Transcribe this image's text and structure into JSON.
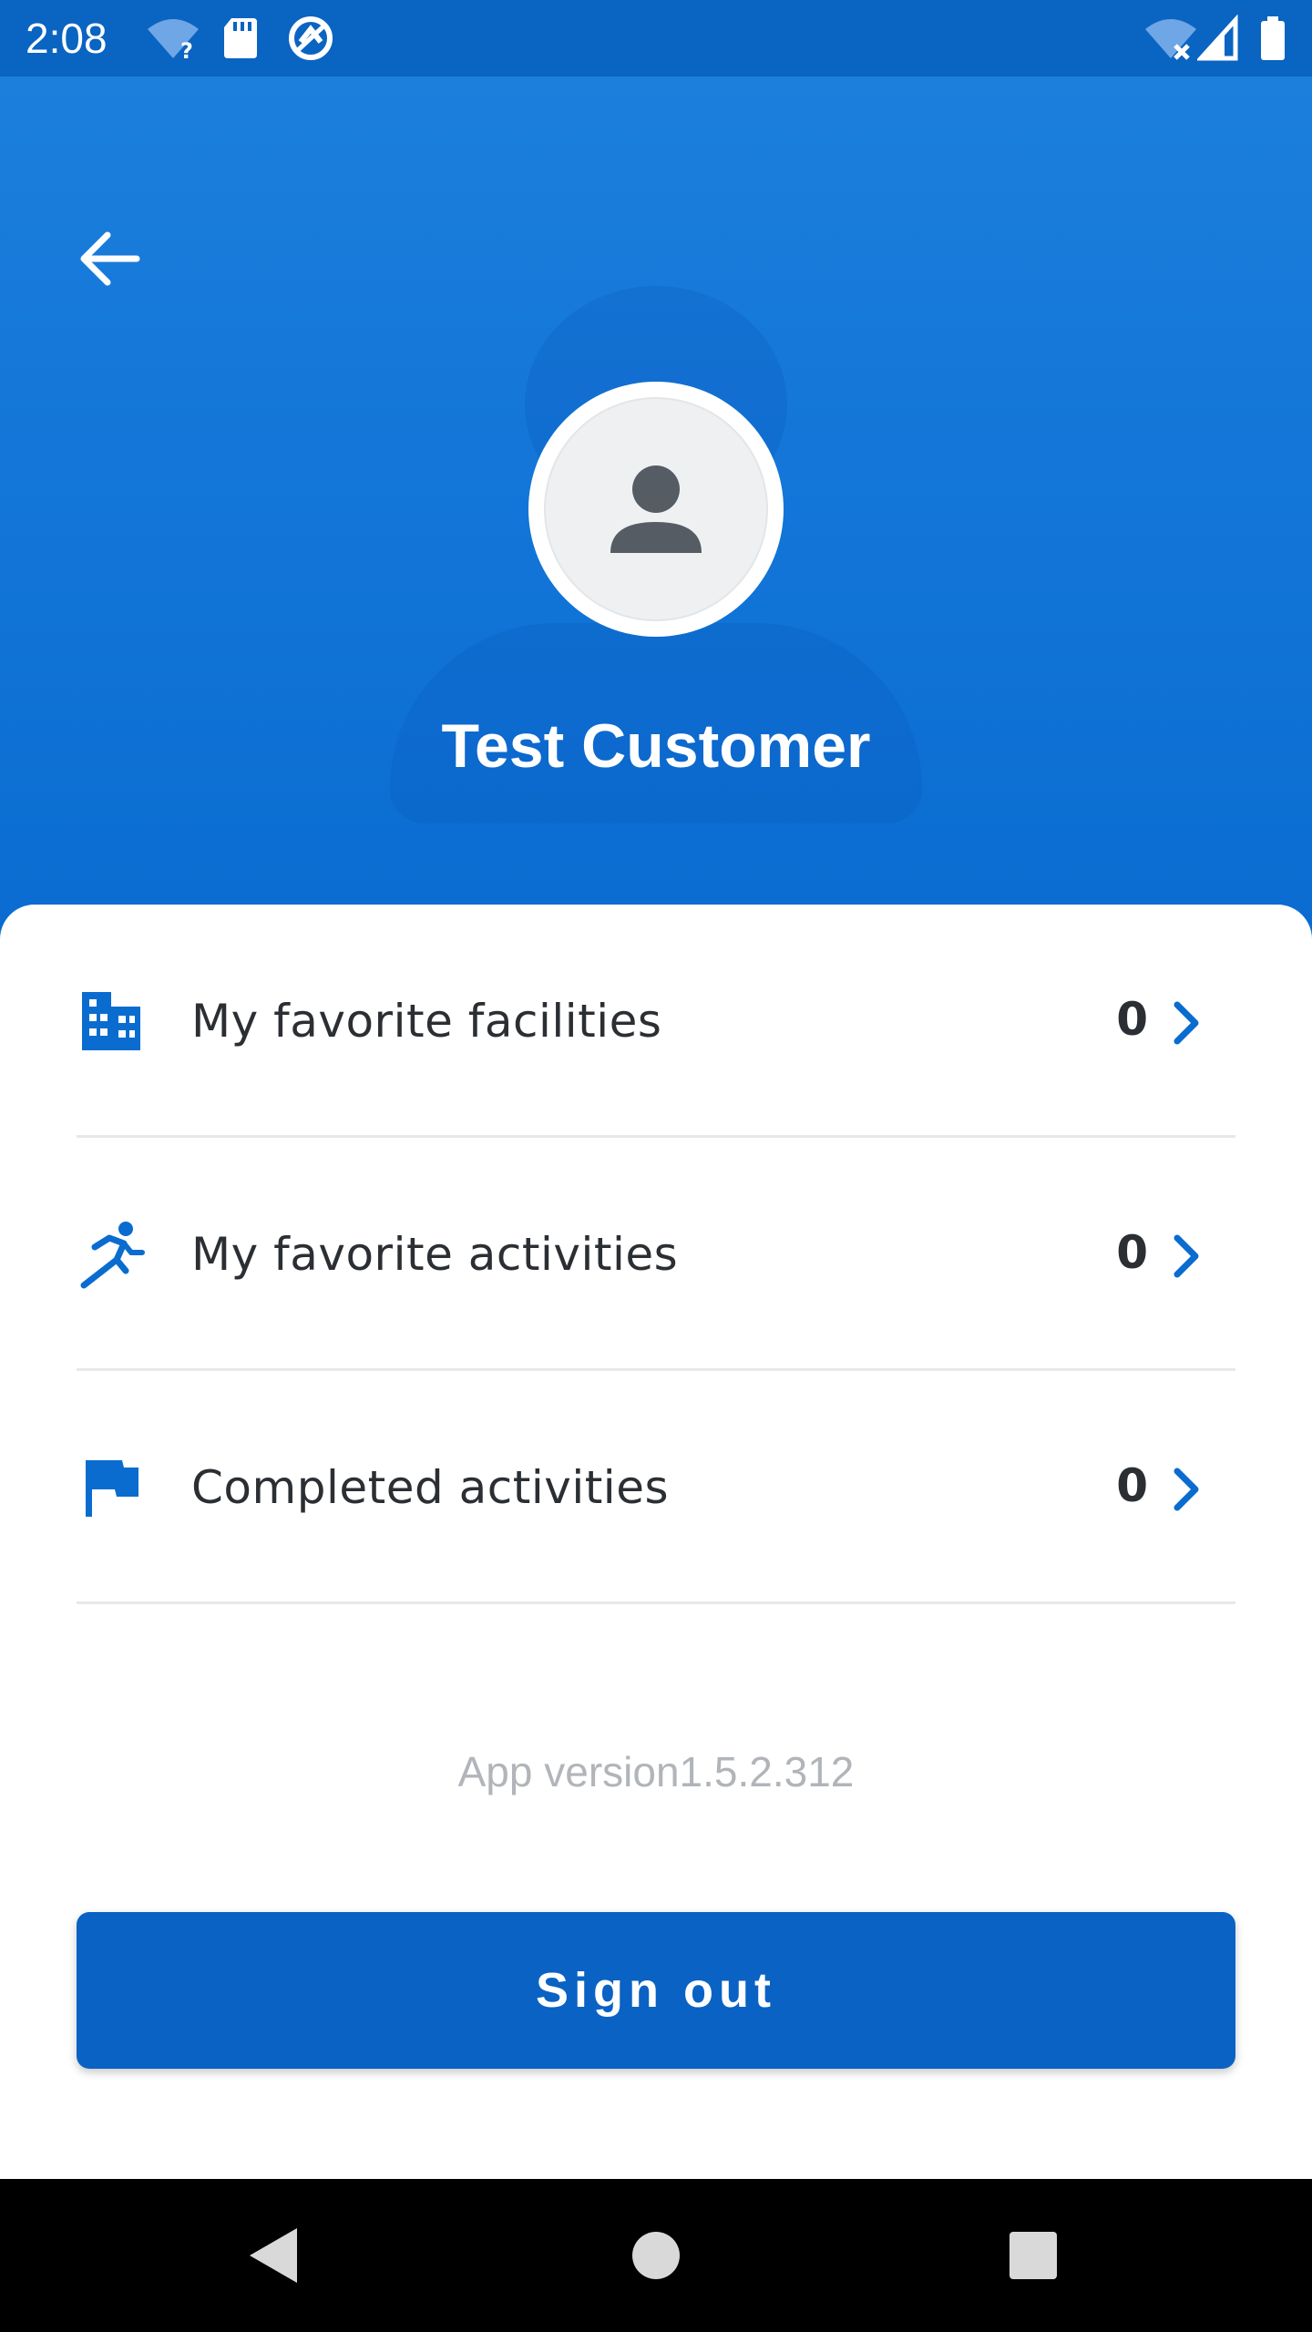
{
  "status_bar": {
    "time": "2:08",
    "icons": [
      "wifi-unknown-icon",
      "sd-card-icon",
      "sync-icon",
      "wifi-off-icon",
      "signal-icon",
      "battery-icon"
    ]
  },
  "header": {
    "back_icon": "arrow-back-icon",
    "avatar_icon": "person-icon",
    "name": "Test Customer"
  },
  "menu": {
    "items": [
      {
        "icon": "building-icon",
        "label": "My favorite facilities",
        "count": "0"
      },
      {
        "icon": "runner-icon",
        "label": "My favorite activities",
        "count": "0"
      },
      {
        "icon": "flag-icon",
        "label": "Completed activities",
        "count": "0"
      }
    ]
  },
  "app_version": "App version1.5.2.312",
  "sign_out_label": "Sign out",
  "nav": {
    "icons": [
      "back-triangle-icon",
      "home-circle-icon",
      "recents-square-icon"
    ]
  },
  "colors": {
    "primary": "#0a62c4",
    "header_top": "#1c7fdc",
    "header_bottom": "#0a6cd0",
    "icon_blue": "#0a6ccf",
    "text_dark": "#2b2f33",
    "text_muted": "#b1b5b9"
  }
}
